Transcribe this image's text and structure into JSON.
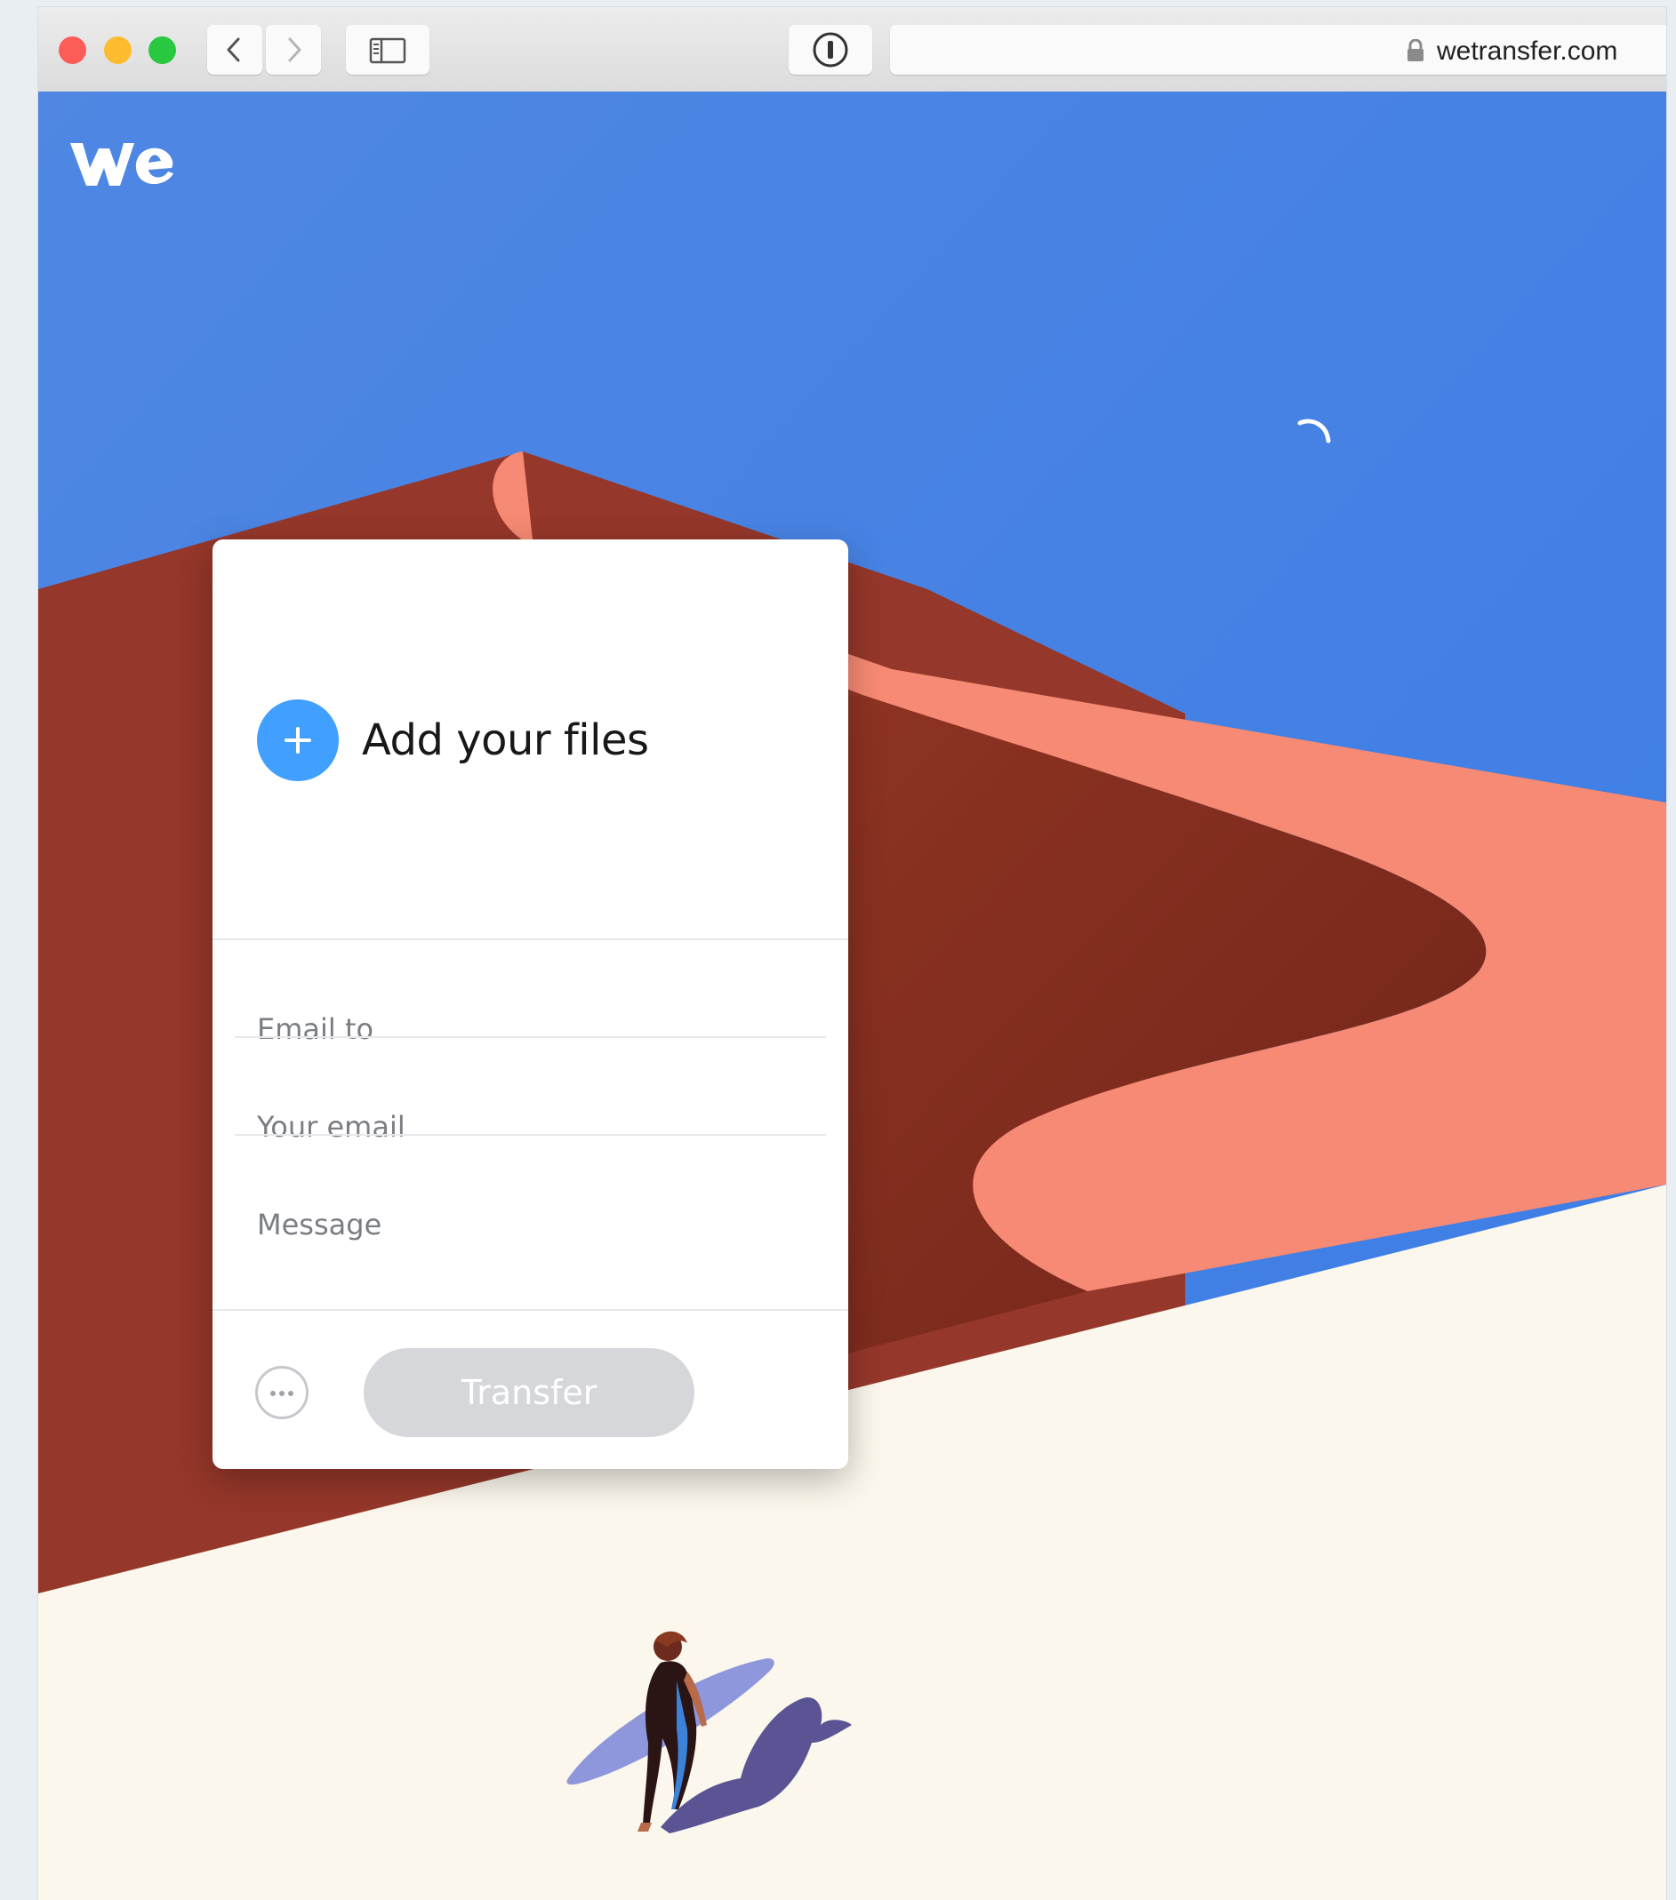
{
  "browser": {
    "url": "wetransfer.com"
  },
  "site": {
    "logo_text": "we"
  },
  "upload_card": {
    "add_files_label": "Add your files",
    "email_to_placeholder": "Email to",
    "your_email_placeholder": "Your email",
    "message_placeholder": "Message",
    "transfer_label": "Transfer",
    "more_options_icon": "ellipsis-icon"
  },
  "colors": {
    "sky": "#4385e6",
    "accent": "#409fff",
    "disabled_button": "#d5d7da",
    "sand_light": "#fbf7ec",
    "dune_dark": "#8c3423",
    "dune_light": "#f78c76"
  }
}
